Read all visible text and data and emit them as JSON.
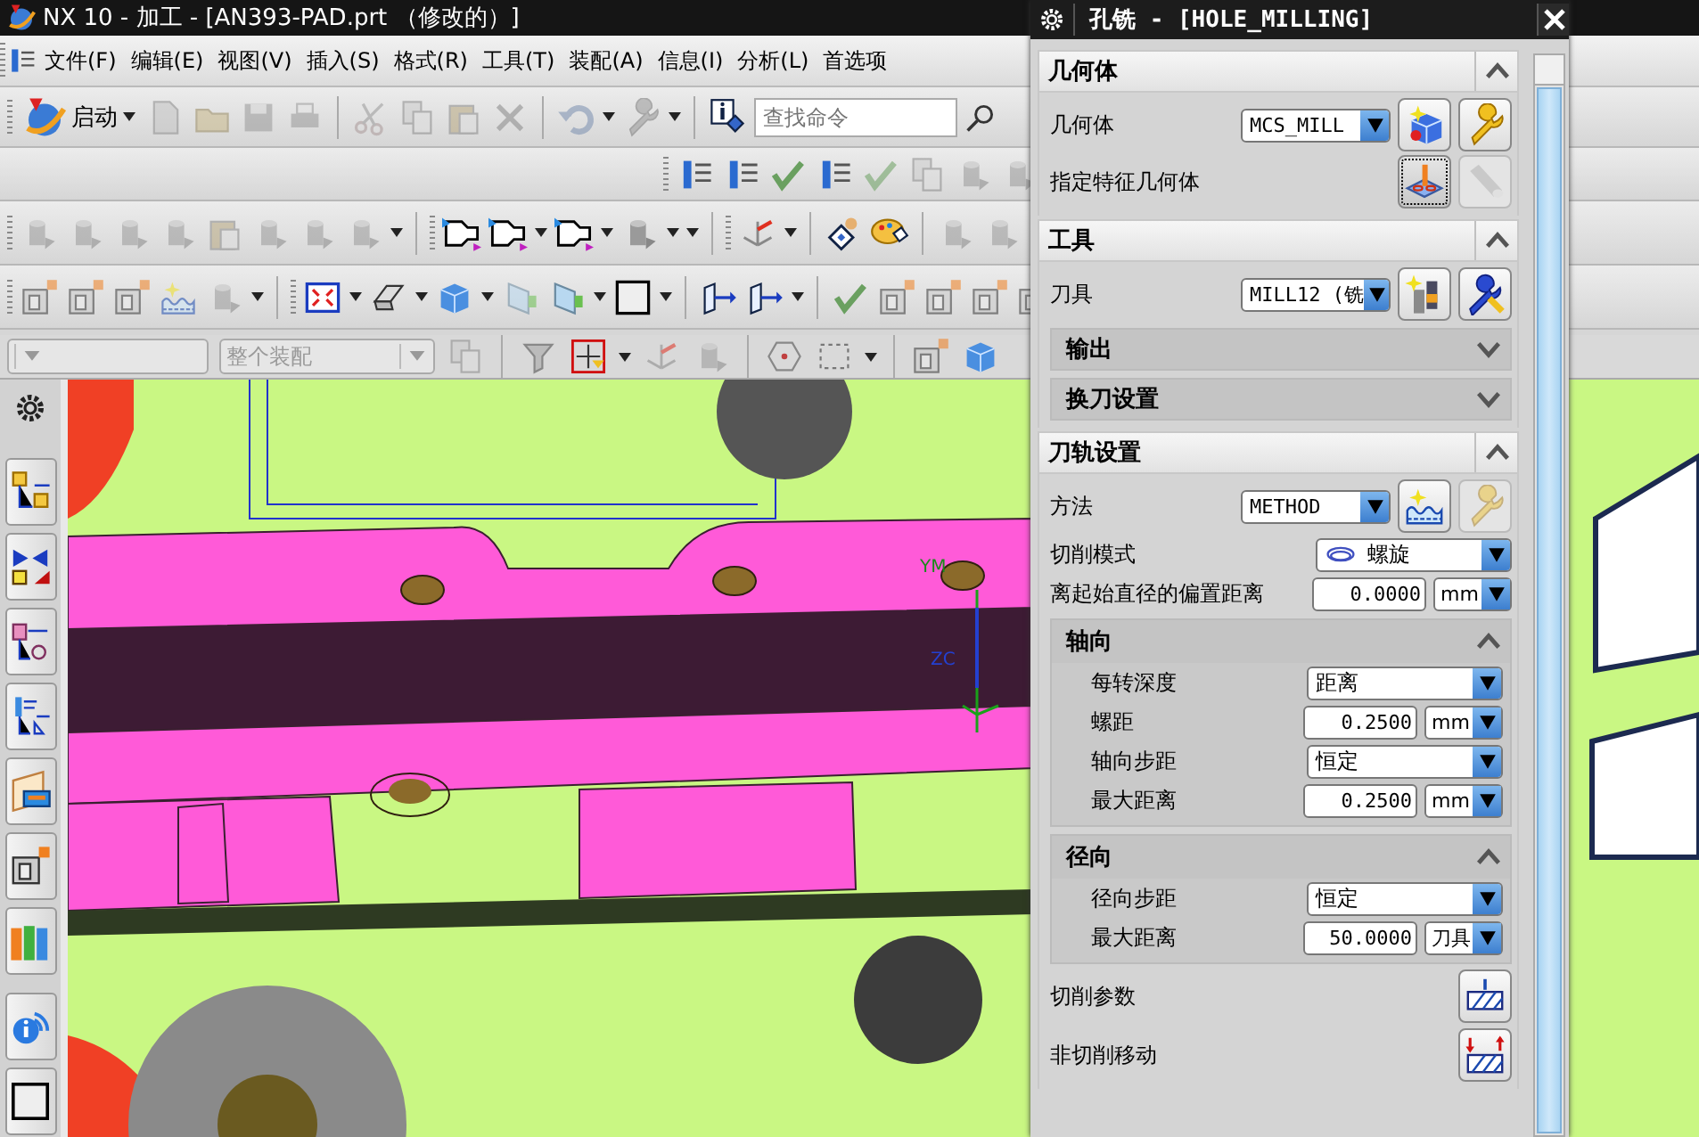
{
  "window": {
    "title": "NX 10 - 加工 - [AN393-PAD.prt （修改的）]"
  },
  "menu": [
    "文件(F)",
    "编辑(E)",
    "视图(V)",
    "插入(S)",
    "格式(R)",
    "工具(T)",
    "装配(A)",
    "信息(I)",
    "分析(L)",
    "首选项"
  ],
  "toolbar": {
    "start_button": "启动",
    "search": {
      "placeholder": "查找命令"
    }
  },
  "filter_bar": {
    "scope": {
      "value": "整个装配",
      "disabled": true
    }
  },
  "viewport": {
    "axis_labels": [
      "YM",
      "ZC"
    ]
  },
  "dialog": {
    "title": "孔铣 - [HOLE_MILLING]",
    "sections": [
      {
        "label": "几何体",
        "expanded": true,
        "items": [
          {
            "kind": "select_buttons",
            "label": "几何体",
            "value": "MCS_MILL",
            "buttons": [
              {
                "kind": "new_geometry",
                "disabled": false,
                "selected": false
              },
              {
                "kind": "edit",
                "disabled": false,
                "selected": false
              }
            ]
          },
          {
            "kind": "buttons",
            "label": "指定特征几何体",
            "buttons": [
              {
                "kind": "specify_feature",
                "disabled": false,
                "selected": true
              },
              {
                "kind": "display",
                "disabled": true,
                "selected": false
              }
            ]
          }
        ]
      },
      {
        "label": "工具",
        "expanded": true,
        "items": [
          {
            "kind": "select_buttons",
            "label": "刀具",
            "value": "MILL12 (铣",
            "buttons": [
              {
                "kind": "new_tool",
                "disabled": false,
                "selected": false
              },
              {
                "kind": "edit_tool",
                "disabled": false,
                "selected": false
              }
            ]
          },
          {
            "kind": "subsection",
            "label": "输出",
            "expanded": false
          },
          {
            "kind": "subsection",
            "label": "换刀设置",
            "expanded": false
          }
        ]
      },
      {
        "label": "刀轨设置",
        "expanded": true,
        "items": [
          {
            "kind": "select_buttons",
            "label": "方法",
            "value": "METHOD",
            "buttons": [
              {
                "kind": "new_method",
                "disabled": false,
                "selected": false
              },
              {
                "kind": "edit",
                "disabled": true,
                "selected": false
              }
            ]
          },
          {
            "kind": "select_icon",
            "label": "切削模式",
            "value": "螺旋"
          },
          {
            "kind": "number_unit",
            "label": "离起始直径的偏置距离",
            "value": "0.0000",
            "unit": "mm"
          },
          {
            "kind": "subsection",
            "label": "轴向",
            "expanded": true,
            "items": [
              {
                "kind": "select",
                "label": "每转深度",
                "value": "距离"
              },
              {
                "kind": "number_unit",
                "label": "螺距",
                "value": "0.2500",
                "unit": "mm"
              },
              {
                "kind": "select",
                "label": "轴向步距",
                "value": "恒定"
              },
              {
                "kind": "number_unit",
                "label": "最大距离",
                "value": "0.2500",
                "unit": "mm"
              }
            ]
          },
          {
            "kind": "subsection",
            "label": "径向",
            "expanded": true,
            "items": [
              {
                "kind": "select",
                "label": "径向步距",
                "value": "恒定"
              },
              {
                "kind": "number_unit",
                "label": "最大距离",
                "value": "50.0000",
                "unit": "刀具"
              }
            ]
          },
          {
            "kind": "action",
            "label": "切削参数",
            "button": {
              "kind": "cut_parameters",
              "disabled": false,
              "selected": false
            }
          },
          {
            "kind": "action",
            "label": "非切削移动",
            "button": {
              "kind": "non_cutting_moves",
              "disabled": false,
              "selected": false
            }
          }
        ]
      }
    ]
  }
}
